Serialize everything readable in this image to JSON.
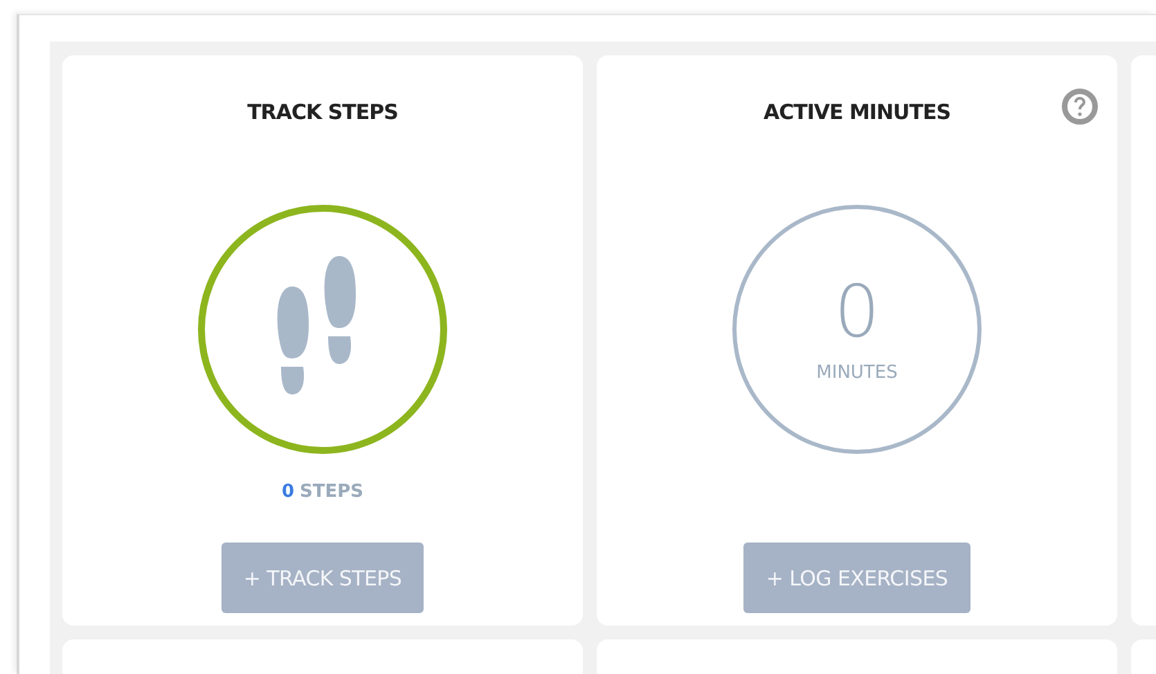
{
  "cards": [
    {
      "kind": "steps",
      "title": "TRACK STEPS",
      "color": "#8db51e",
      "count": "0",
      "unit": "STEPS",
      "button": "+ TRACK STEPS",
      "help": false
    },
    {
      "kind": "minutes",
      "title": "ACTIVE MINUTES",
      "color": "#a9b8c9",
      "count": "0",
      "unit": "MINUTES",
      "button": "+ LOG EXERCISES",
      "help": true
    }
  ]
}
